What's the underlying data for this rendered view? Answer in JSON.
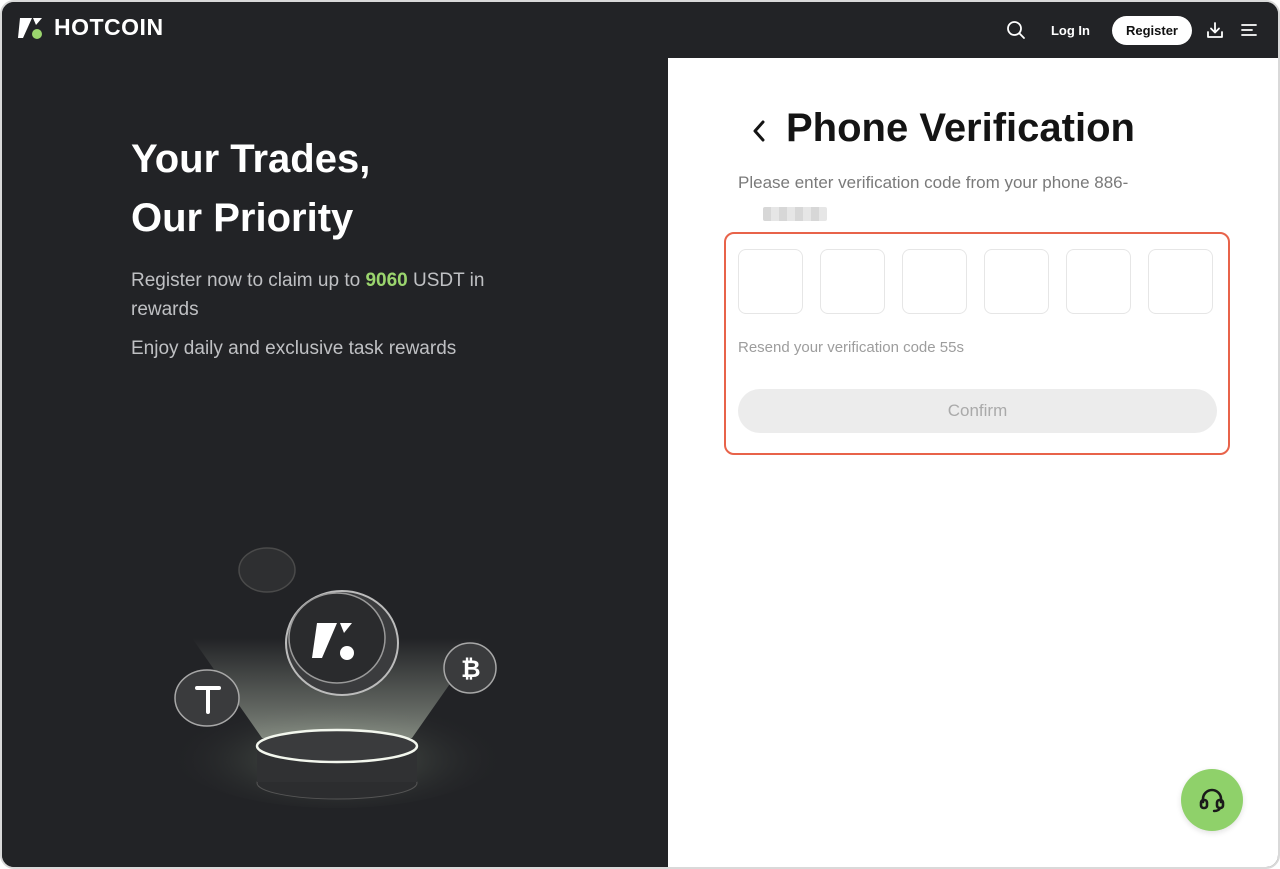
{
  "header": {
    "brand": "HOTCOIN",
    "login_label": "Log In",
    "register_label": "Register",
    "icons": [
      "search-icon",
      "download-icon",
      "menu-icon"
    ]
  },
  "hero": {
    "headline_line1": "Your Trades,",
    "headline_line2": "Our Priority",
    "promo_prefix": "Register now to claim up to ",
    "promo_amount": "9060",
    "promo_suffix": " USDT in rewards",
    "promo_line2": "Enjoy daily and exclusive task rewards"
  },
  "verification": {
    "title": "Phone Verification",
    "subtitle": "Please enter verification code from your phone 886-",
    "code_digits": [
      "",
      "",
      "",
      "",
      "",
      ""
    ],
    "resend_text": "Resend your verification code 55s",
    "confirm_label": "Confirm"
  },
  "colors": {
    "accent_green": "#9bd56e",
    "highlight_border": "#e8634a",
    "dark_bg": "#222326"
  },
  "support": {
    "icon": "headset-icon"
  }
}
